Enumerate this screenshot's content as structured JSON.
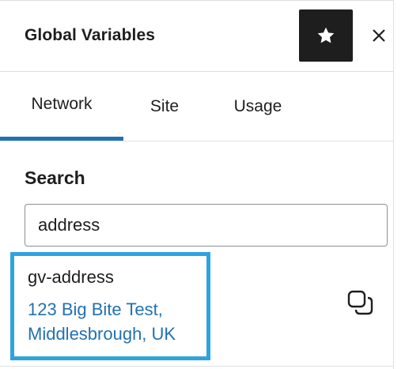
{
  "header": {
    "title": "Global Variables",
    "favorite_icon": "star-icon",
    "close_icon": "close-icon"
  },
  "tabs": [
    {
      "label": "Network",
      "active": true
    },
    {
      "label": "Site",
      "active": false
    },
    {
      "label": "Usage",
      "active": false
    }
  ],
  "search": {
    "label": "Search",
    "value": "address"
  },
  "results": [
    {
      "name": "gv-address",
      "value": "123 Big Bite Test,\nMiddlesbrough, UK",
      "action_icon": "copy-icon"
    }
  ],
  "colors": {
    "accent": "#2271b1",
    "highlight": "#2ea3e0",
    "dark_button": "#1e1e1e"
  }
}
